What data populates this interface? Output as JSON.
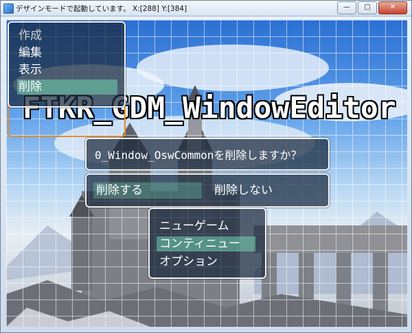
{
  "window": {
    "title": "デザインモードで起動しています。 X:[288] Y:[384]",
    "minimize_label": "—",
    "maximize_label": "□",
    "close_label": "✕"
  },
  "game": {
    "title": "FTKR_GDM_WindowEditor"
  },
  "editor_menu": {
    "items": [
      {
        "label": "作成",
        "state": "disabled"
      },
      {
        "label": "編集",
        "state": "normal"
      },
      {
        "label": "表示",
        "state": "normal"
      },
      {
        "label": "削除",
        "state": "selected"
      }
    ]
  },
  "confirm": {
    "message": "0_Window_OswCommonを削除しますか？",
    "yes_label": "削除する",
    "no_label": "削除しない"
  },
  "title_menu": {
    "items": [
      {
        "label": "ニューゲーム",
        "state": "normal"
      },
      {
        "label": "コンティニュー",
        "state": "selected"
      },
      {
        "label": "オプション",
        "state": "normal"
      }
    ]
  },
  "colors": {
    "selection": "#6ec8aa",
    "window_border": "#f3f3f3",
    "orange_frame": "#e38a2a"
  }
}
